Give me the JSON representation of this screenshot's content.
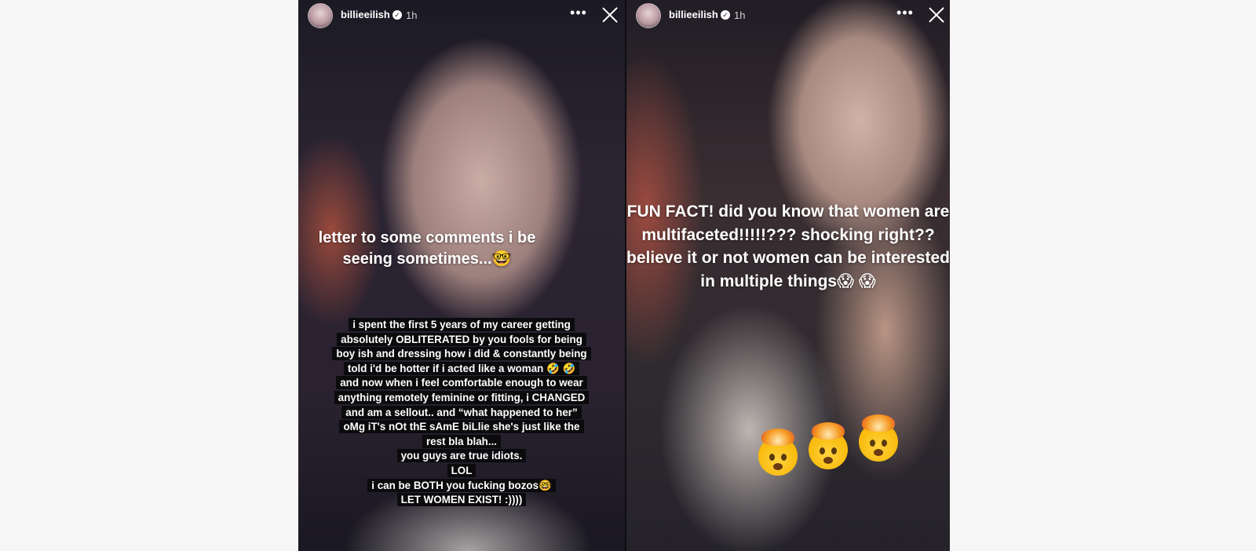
{
  "stories": [
    {
      "username": "billieeilish",
      "time": "1h",
      "title": "letter to some comments i be seeing sometimes...🤓",
      "caption_lines": [
        "i spent the first 5 years of my career getting",
        "absolutely OBLITERATED by you fools for being",
        "boy ish and dressing how i did & constantly being",
        "told i'd be hotter if i acted like a woman 🤣 🤣",
        "and now when i feel comfortable enough to wear",
        "anything remotely feminine or fitting, i CHANGED",
        "and am a sellout.. and “what happened to her”",
        "oMg iT's nOt thE sAmE biLlie she's just like the",
        "rest bla blah...",
        "you guys are true idiots.",
        "LOL",
        "i can be BOTH you fucking bozos🤓",
        "LET WOMEN EXIST! :))))"
      ]
    },
    {
      "username": "billieeilish",
      "time": "1h",
      "title": "FUN FACT! did you know that women are multifaceted!!!!!??? shocking right?? believe it or not women can be interested in multiple things😱 😱",
      "sticker": "🤯🤯🤯"
    }
  ],
  "icons": {
    "verified": "verified-badge-icon",
    "more": "more-options-icon",
    "close": "close-icon"
  },
  "colors": {
    "page_background": "#f7f6f6",
    "caption_background": "#0b0b0d",
    "text": "#ffffff"
  }
}
